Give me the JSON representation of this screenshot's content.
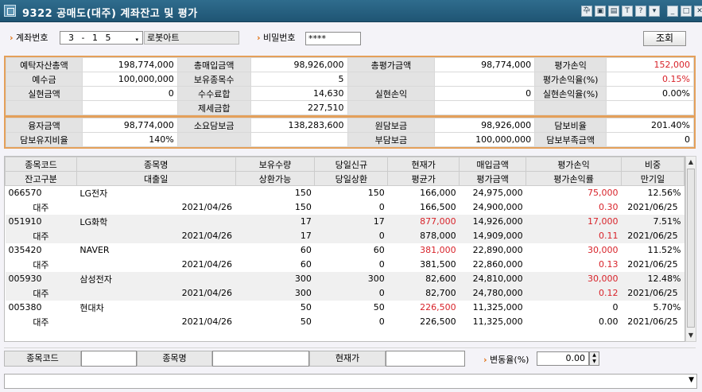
{
  "window": {
    "title": "9322 공매도(대주) 계좌잔고 및 평가",
    "controls": [
      "pin-icon",
      "save-icon",
      "print-icon",
      "text-icon",
      "help-icon",
      "dropdown-icon",
      "minimize-icon",
      "maximize-icon",
      "close-icon"
    ],
    "control_glyphs": [
      "卆",
      "▣",
      "▤",
      "T",
      "?",
      "▾",
      "_",
      "□",
      "✕"
    ]
  },
  "search": {
    "account_label": "계좌번호",
    "account_value": "3 - 1 5",
    "account_name": "로봇아트",
    "password_label": "비밀번호",
    "password_value": "****",
    "query_button": "조회"
  },
  "summary": {
    "rows1": [
      [
        "예탁자산총액",
        "198,774,000",
        "총매입금액",
        "98,926,000",
        "총평가금액",
        "98,774,000",
        "평가손익",
        "152,000"
      ],
      [
        "예수금",
        "100,000,000",
        "보유종목수",
        "5",
        "",
        "",
        "평가손익율(%)",
        "0.15%"
      ],
      [
        "실현금액",
        "0",
        "수수료합",
        "14,630",
        "실현손익",
        "0",
        "실현손익율(%)",
        "0.00%"
      ],
      [
        "",
        "",
        "제세금합",
        "227,510",
        "",
        "",
        "",
        ""
      ]
    ],
    "rows2": [
      [
        "융자금액",
        "98,774,000",
        "소요담보금",
        "138,283,600",
        "원담보금",
        "98,926,000",
        "담보비율",
        "201.40%"
      ],
      [
        "담보유지비율",
        "140%",
        "",
        "",
        "부담보금",
        "100,000,000",
        "담보부족금액",
        "0"
      ]
    ]
  },
  "grid": {
    "header1": [
      "종목코드",
      "종목명",
      "보유수량",
      "당일신규",
      "현재가",
      "매입금액",
      "평가손익",
      "비중"
    ],
    "header2": [
      "잔고구분",
      "대출일",
      "상환가능",
      "당일상환",
      "평균가",
      "평가금액",
      "평가손익률",
      "만기일"
    ],
    "rows": [
      [
        "066570",
        "LG전자",
        "150",
        "150",
        "166,000",
        "24,975,000",
        "75,000",
        "12.56%"
      ],
      [
        "대주",
        "2021/04/26",
        "150",
        "0",
        "166,500",
        "24,900,000",
        "0.30",
        "2021/06/25"
      ],
      [
        "051910",
        "LG화학",
        "17",
        "17",
        "877,000",
        "14,926,000",
        "17,000",
        "7.51%"
      ],
      [
        "대주",
        "2021/04/26",
        "17",
        "0",
        "878,000",
        "14,909,000",
        "0.11",
        "2021/06/25"
      ],
      [
        "035420",
        "NAVER",
        "60",
        "60",
        "381,000",
        "22,890,000",
        "30,000",
        "11.52%"
      ],
      [
        "대주",
        "2021/04/26",
        "60",
        "0",
        "381,500",
        "22,860,000",
        "0.13",
        "2021/06/25"
      ],
      [
        "005930",
        "삼성전자",
        "300",
        "300",
        "82,600",
        "24,810,000",
        "30,000",
        "12.48%"
      ],
      [
        "대주",
        "2021/04/26",
        "300",
        "0",
        "82,700",
        "24,780,000",
        "0.12",
        "2021/06/25"
      ],
      [
        "005380",
        "현대차",
        "50",
        "50",
        "226,500",
        "11,325,000",
        "0",
        "5.70%"
      ],
      [
        "대주",
        "2021/04/26",
        "50",
        "0",
        "226,500",
        "11,325,000",
        "0.00",
        "2021/06/25"
      ]
    ]
  },
  "bottom": {
    "code_label": "종목코드",
    "name_label": "종목명",
    "price_label": "현재가",
    "rate_label": "변동율(%)",
    "rate_value": "0.00"
  },
  "colors": {
    "accent_orange": "#e07010",
    "red": "#d8232a",
    "title_bg": "#1f5574"
  }
}
